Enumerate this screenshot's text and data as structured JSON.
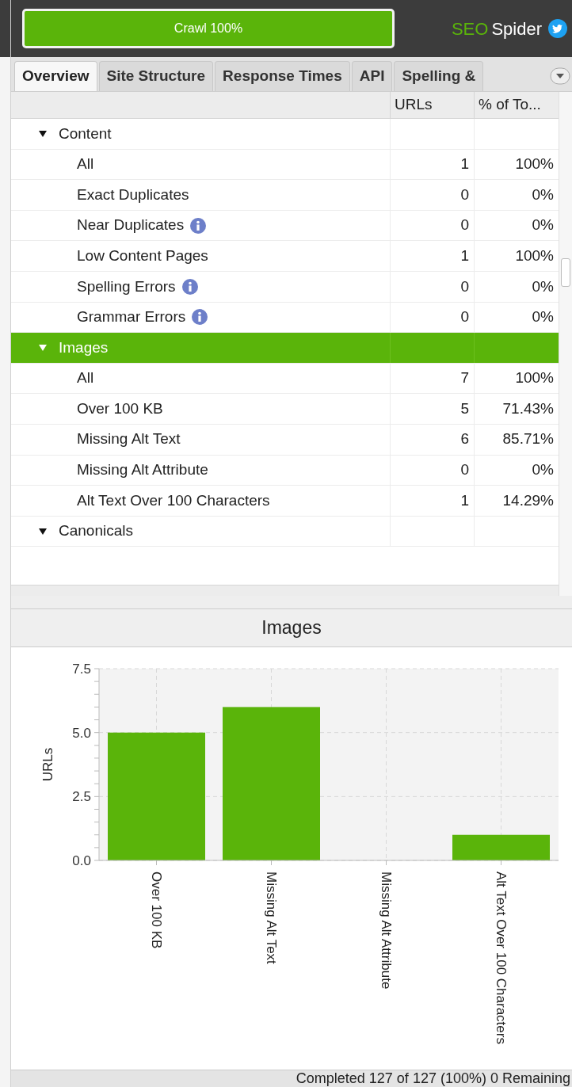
{
  "top_bar": {
    "progress": {
      "label": "Crawl 100%",
      "level": 1
    },
    "brand": {
      "accent": "SEO",
      "name": "Spider"
    }
  },
  "tabs": [
    {
      "label": "Overview",
      "selected": true
    },
    {
      "label": "Site Structure",
      "selected": false
    },
    {
      "label": "Response Times",
      "selected": false
    },
    {
      "label": "API",
      "selected": false
    },
    {
      "label": "Spelling &",
      "selected": false
    }
  ],
  "table": {
    "columns": [
      "URLs",
      "% of To..."
    ],
    "groups": [
      {
        "label": "Content",
        "expanded": true,
        "selected": false,
        "children": [
          {
            "label": "All",
            "info": false,
            "urls": "1",
            "percent": "100%"
          },
          {
            "label": "Exact Duplicates",
            "info": false,
            "urls": "0",
            "percent": "0%"
          },
          {
            "label": "Near Duplicates",
            "info": true,
            "urls": "0",
            "percent": "0%"
          },
          {
            "label": "Low Content Pages",
            "info": false,
            "urls": "1",
            "percent": "100%"
          },
          {
            "label": "Spelling Errors",
            "info": true,
            "urls": "0",
            "percent": "0%"
          },
          {
            "label": "Grammar Errors",
            "info": true,
            "urls": "0",
            "percent": "0%"
          }
        ]
      },
      {
        "label": "Images",
        "expanded": true,
        "selected": true,
        "children": [
          {
            "label": "All",
            "info": false,
            "urls": "7",
            "percent": "100%"
          },
          {
            "label": "Over 100 KB",
            "info": false,
            "urls": "5",
            "percent": "71.43%"
          },
          {
            "label": "Missing Alt Text",
            "info": false,
            "urls": "6",
            "percent": "85.71%"
          },
          {
            "label": "Missing Alt Attribute",
            "info": false,
            "urls": "0",
            "percent": "0%"
          },
          {
            "label": "Alt Text Over 100 Characters",
            "info": false,
            "urls": "1",
            "percent": "14.29%"
          }
        ]
      },
      {
        "label": "Canonicals",
        "expanded": true,
        "selected": false
      }
    ]
  },
  "chart_panel": {
    "title": "Images",
    "chart_data": {
      "type": "bar",
      "ylabel": "URLs",
      "categories": [
        "Over 100 KB",
        "Missing Alt Text",
        "Missing Alt Attribute",
        "Alt Text Over 100 Characters"
      ],
      "values": [
        5,
        6,
        0,
        1
      ],
      "ylim": [
        0,
        7.5
      ],
      "grid": true,
      "yticks": [
        {
          "value": 0,
          "label": "0.0"
        },
        {
          "value": 2.5,
          "label": "2.5"
        },
        {
          "value": 5,
          "label": "5.0"
        },
        {
          "value": 7.5,
          "label": "7.5"
        }
      ]
    }
  },
  "status_bar": "Completed 127 of 127 (100%) 0 Remaining"
}
